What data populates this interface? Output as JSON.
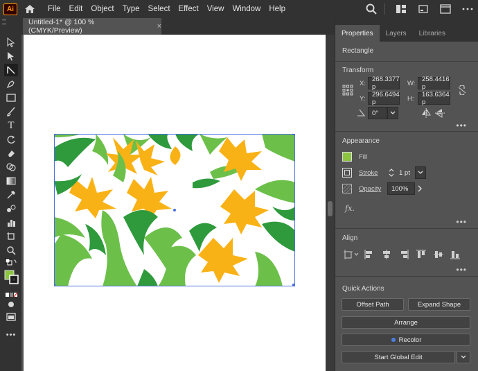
{
  "app": {
    "logo": "Ai"
  },
  "menu": [
    "File",
    "Edit",
    "Object",
    "Type",
    "Select",
    "Effect",
    "View",
    "Window",
    "Help"
  ],
  "document": {
    "tab_title": "Untitled-1* @ 100 % (CMYK/Preview)",
    "close": "×"
  },
  "panel": {
    "tabs": [
      "Properties",
      "Layers",
      "Libraries"
    ],
    "selection_type": "Rectangle",
    "transform": {
      "title": "Transform",
      "x_label": "X:",
      "x_value": "268.3377 p",
      "y_label": "Y:",
      "y_value": "296.6494 p",
      "w_label": "W:",
      "w_value": "258.4416 p",
      "h_label": "H:",
      "h_value": "163.6364 p",
      "rotate_value": "0°"
    },
    "appearance": {
      "title": "Appearance",
      "fill_label": "Fill",
      "stroke_label": "Stroke",
      "stroke_value": "1 pt",
      "opacity_label": "Opacity",
      "opacity_value": "100%",
      "fx_label": "fx."
    },
    "align": {
      "title": "Align"
    },
    "quick_actions": {
      "title": "Quick Actions",
      "offset_path": "Offset Path",
      "expand_shape": "Expand Shape",
      "arrange": "Arrange",
      "recolor": "Recolor",
      "start_global_edit": "Start Global Edit"
    },
    "more": "•••"
  },
  "colors": {
    "fill_green": "#8cc63f",
    "dark_green": "#2e9a3c",
    "leaf_green": "#6cc04a",
    "orange": "#f9b216",
    "selection_blue": "#4a6ee0"
  }
}
